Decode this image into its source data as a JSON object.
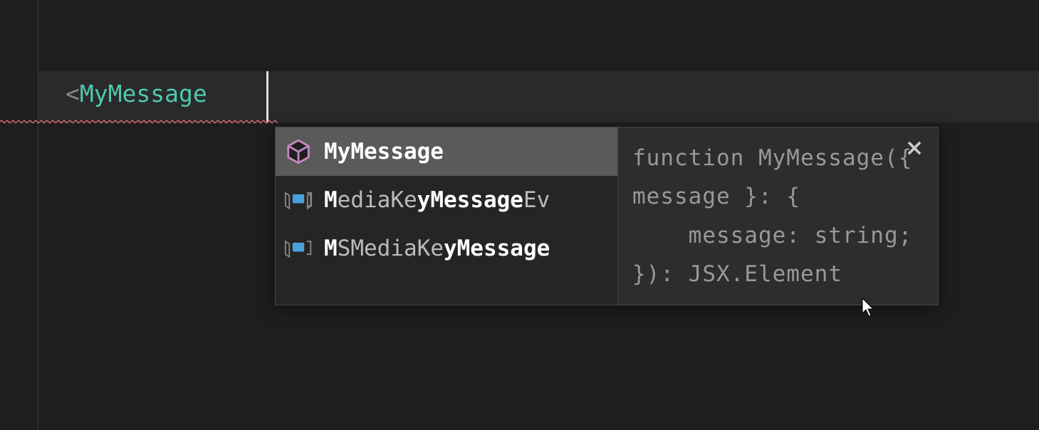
{
  "editor": {
    "code_prefix": "<",
    "code_component": "MyMessage"
  },
  "suggestions": {
    "items": [
      {
        "label_pre": "",
        "label_match": "MyMessage",
        "label_post": ""
      },
      {
        "label_pre_1": "M",
        "label_mid_1": "ediaKe",
        "label_match": "yMessage",
        "label_post": "Ev"
      },
      {
        "label_pre_1": "M",
        "label_mid_1": "SMediaKe",
        "label_match": "yMessage",
        "label_post": ""
      }
    ]
  },
  "detail": {
    "signature": "function MyMessage({ message }: {\n    message: string;\n}): JSX.Element"
  }
}
